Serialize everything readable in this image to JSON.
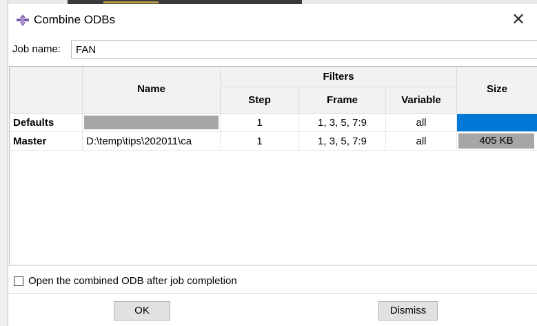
{
  "window": {
    "title": "Combine ODBs",
    "close_glyph": "✕",
    "icon": "abaqus-logo-icon"
  },
  "job": {
    "label": "Job name:",
    "value": "FAN"
  },
  "table": {
    "headers": {
      "name": "Name",
      "filters": "Filters",
      "step": "Step",
      "frame": "Frame",
      "variable": "Variable",
      "size": "Size"
    },
    "rows": [
      {
        "label": "Defaults",
        "name": "",
        "step": "1",
        "frame": "1, 3, 5, 7:9",
        "variable": "all",
        "size": ""
      },
      {
        "label": "Master",
        "name": "D:\\temp\\tips\\202011\\ca",
        "step": "1",
        "frame": "1, 3, 5, 7:9",
        "variable": "all",
        "size": "405 KB"
      }
    ]
  },
  "options": {
    "open_after": "Open the combined ODB after job completion",
    "open_after_checked": false
  },
  "buttons": {
    "ok": "OK",
    "dismiss": "Dismiss"
  },
  "colors": {
    "defaults_name_fill": "#a6a6a6",
    "defaults_size_fill": "#0078d7",
    "master_size_fill": "#a6a6a6",
    "header_bg": "#f2f2f2"
  }
}
